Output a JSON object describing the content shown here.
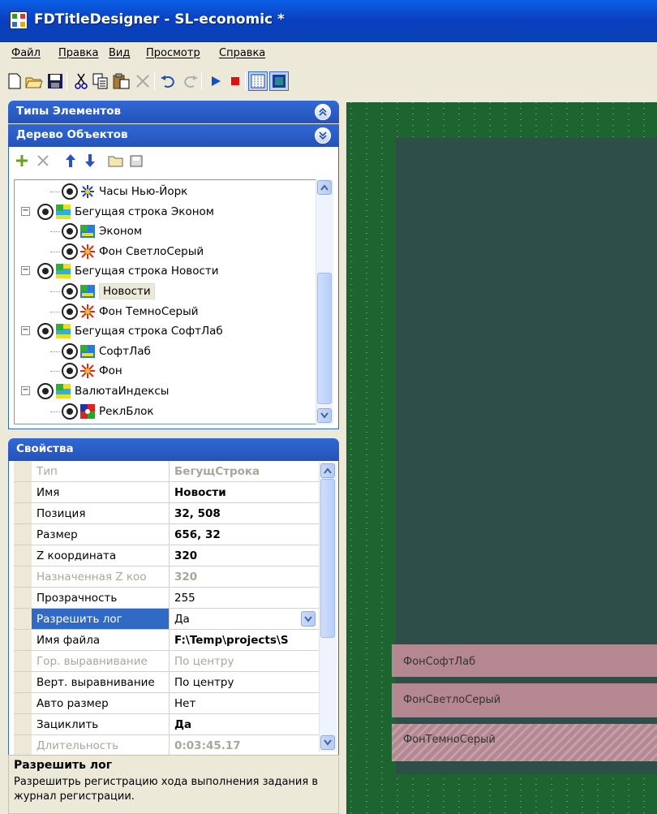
{
  "window": {
    "title": "FDTitleDesigner - SL-economic *"
  },
  "menu": [
    "Файл",
    "Правка",
    "Вид",
    "Просмотр",
    "Справка"
  ],
  "toolbar": {
    "icons": [
      "new-file-icon",
      "open-folder-icon",
      "save-icon",
      "cut-icon",
      "copy-icon",
      "paste-icon",
      "delete-icon",
      "undo-icon",
      "redo-icon",
      "play-icon",
      "stop-icon",
      "grid-icon",
      "frame-icon"
    ]
  },
  "panels": {
    "types": {
      "title": "Типы Элементов"
    },
    "tree": {
      "title": "Дерево Объектов"
    },
    "properties": {
      "title": "Свойства"
    }
  },
  "tree": {
    "items": [
      {
        "label": "Часы Нью-Йорк",
        "level": 2,
        "icon": "clock-icon"
      },
      {
        "label": "Бегущая строка Эконом",
        "level": 1,
        "icon": "ticker-icon",
        "expander": "−"
      },
      {
        "label": "Эконом",
        "level": 2,
        "icon": "text-block-icon"
      },
      {
        "label": "Фон СветлоСерый",
        "level": 2,
        "icon": "background-icon"
      },
      {
        "label": "Бегущая строка Новости",
        "level": 1,
        "icon": "ticker-icon",
        "expander": "−"
      },
      {
        "label": "Новости",
        "level": 2,
        "icon": "text-block-icon",
        "selected": true
      },
      {
        "label": "Фон ТемноСерый",
        "level": 2,
        "icon": "background-icon"
      },
      {
        "label": "Бегущая строка СофтЛаб",
        "level": 1,
        "icon": "ticker-icon",
        "expander": "−"
      },
      {
        "label": "СофтЛаб",
        "level": 2,
        "icon": "text-block-icon"
      },
      {
        "label": "Фон",
        "level": 2,
        "icon": "background-icon"
      },
      {
        "label": "ВалютаИндексы",
        "level": 1,
        "icon": "ticker-icon",
        "expander": "−"
      },
      {
        "label": "РеклБлок",
        "level": 2,
        "icon": "ad-block-icon"
      }
    ]
  },
  "properties": {
    "rows": [
      {
        "name": "Тип",
        "value": "БегущСтрока",
        "disabled": true,
        "bold": true
      },
      {
        "name": "Имя",
        "value": "Новости",
        "bold": true
      },
      {
        "name": "Позиция",
        "value": "32, 508",
        "bold": true
      },
      {
        "name": "Размер",
        "value": "656, 32",
        "bold": true
      },
      {
        "name": "Z координата",
        "value": "320",
        "bold": true
      },
      {
        "name": "Назначенная Z коо",
        "value": "320",
        "disabled": true,
        "bold": true
      },
      {
        "name": "Прозрачность",
        "value": "255"
      },
      {
        "name": "Разрешить лог",
        "value": "Да",
        "selected": true,
        "dropdown": true
      },
      {
        "name": "Имя файла",
        "value": "F:\\Temp\\projects\\S",
        "bold": true
      },
      {
        "name": "Гор. выравнивание",
        "value": "По центру",
        "disabled": true
      },
      {
        "name": "Верт. выравнивание",
        "value": "По центру"
      },
      {
        "name": "Авто размер",
        "value": "Нет"
      },
      {
        "name": "Зациклить",
        "value": "Да",
        "bold": true
      },
      {
        "name": "Длительность",
        "value": "0:03:45.17",
        "disabled": true,
        "bold": true
      }
    ]
  },
  "help": {
    "title": "Разрешить лог",
    "text": "Разрешитрь регистрацию хода выполнения задания в журнал регистрации."
  },
  "canvas": {
    "labels": [
      {
        "text": "ФонСофтЛаб"
      },
      {
        "text": "ФонСветлоСерый"
      },
      {
        "text": "ФонТемноСерый"
      }
    ]
  },
  "colors": {
    "title_bar": "#0A4FD6",
    "panel_head": "#2B5DC6",
    "canvas_bg": "#1E6431",
    "canvas_rect": "#2E4F48",
    "pink_band": "#B98994"
  }
}
